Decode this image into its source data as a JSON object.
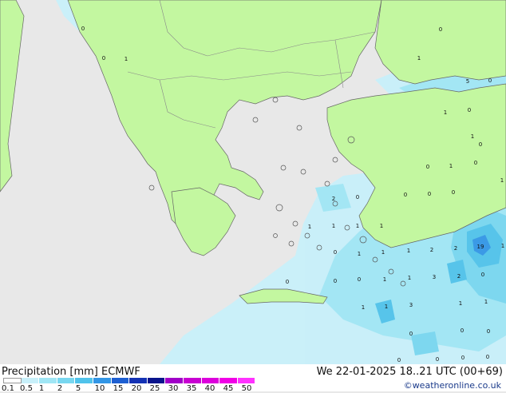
{
  "footer": {
    "title": "Precipitation [mm]  ECMWF",
    "datetime": "We 22-01-2025 18..21 UTC (00+69)",
    "credit": "©weatheronline.co.uk"
  },
  "legend": {
    "ticks": [
      "0.1",
      "0.5",
      "1",
      "2",
      "5",
      "10",
      "15",
      "20",
      "25",
      "30",
      "35",
      "40",
      "45",
      "50"
    ],
    "colors": [
      "#ffffff",
      "#c8f0fa",
      "#a0e6f5",
      "#78d7f0",
      "#50c3eb",
      "#3296e6",
      "#1e5fd2",
      "#1432b4",
      "#0a148c",
      "#a000c8",
      "#c800d2",
      "#dc00dc",
      "#f000e6",
      "#ff32ff"
    ]
  },
  "colors": {
    "land": "#c3f7a0",
    "sea": "#e8e8e8",
    "border": "#777777"
  },
  "value_labels": [
    {
      "text": "0"
    },
    {
      "text": "0"
    },
    {
      "text": "1"
    },
    {
      "text": "0"
    },
    {
      "text": "1"
    },
    {
      "text": "5"
    },
    {
      "text": "0"
    },
    {
      "text": "1"
    },
    {
      "text": "0"
    },
    {
      "text": "1"
    },
    {
      "text": "0"
    },
    {
      "text": "0"
    },
    {
      "text": "1"
    },
    {
      "text": "0"
    },
    {
      "text": "2"
    },
    {
      "text": "0"
    },
    {
      "text": "0"
    },
    {
      "text": "0"
    },
    {
      "text": "0"
    },
    {
      "text": "1"
    },
    {
      "text": "1"
    },
    {
      "text": "1"
    },
    {
      "text": "1"
    },
    {
      "text": "1"
    },
    {
      "text": "0"
    },
    {
      "text": "1"
    },
    {
      "text": "1"
    },
    {
      "text": "1"
    },
    {
      "text": "2"
    },
    {
      "text": "2"
    },
    {
      "text": "19"
    },
    {
      "text": "1"
    },
    {
      "text": "0"
    },
    {
      "text": "0"
    },
    {
      "text": "0"
    },
    {
      "text": "1"
    },
    {
      "text": "1"
    },
    {
      "text": "3"
    },
    {
      "text": "2"
    },
    {
      "text": "0"
    },
    {
      "text": "1"
    },
    {
      "text": "1"
    },
    {
      "text": "3"
    },
    {
      "text": "1"
    },
    {
      "text": "1"
    },
    {
      "text": "0"
    },
    {
      "text": "0"
    },
    {
      "text": "0"
    },
    {
      "text": "0"
    },
    {
      "text": "0"
    },
    {
      "text": "0"
    },
    {
      "text": "0"
    }
  ]
}
